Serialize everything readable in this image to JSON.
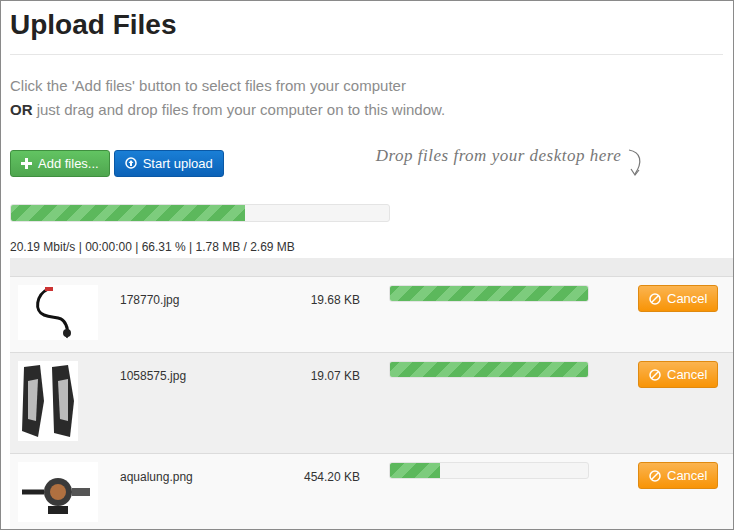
{
  "title": "Upload Files",
  "instructions": {
    "line1": "Click the 'Add files' button to select files from your computer",
    "or": "OR",
    "line2": " just drag and drop files from your computer on to this window."
  },
  "buttons": {
    "add": "Add files...",
    "start": "Start upload"
  },
  "drop_hint": "Drop files from your desktop here",
  "progress": {
    "level": 0.62,
    "stats": "20.19 Mbit/s | 00:00:00 | 66.31 % | 1.78 MB / 2.69 MB"
  },
  "files": [
    {
      "name": "178770.jpg",
      "size": "19.68 KB",
      "level": 1,
      "cancel": "Cancel",
      "kind": "snorkel"
    },
    {
      "name": "1058575.jpg",
      "size": "19.07 KB",
      "level": 1,
      "cancel": "Cancel",
      "kind": "fins"
    },
    {
      "name": "aqualung.png",
      "size": "454.20 KB",
      "level": 0.25,
      "cancel": "Cancel",
      "kind": "regulator"
    }
  ]
}
